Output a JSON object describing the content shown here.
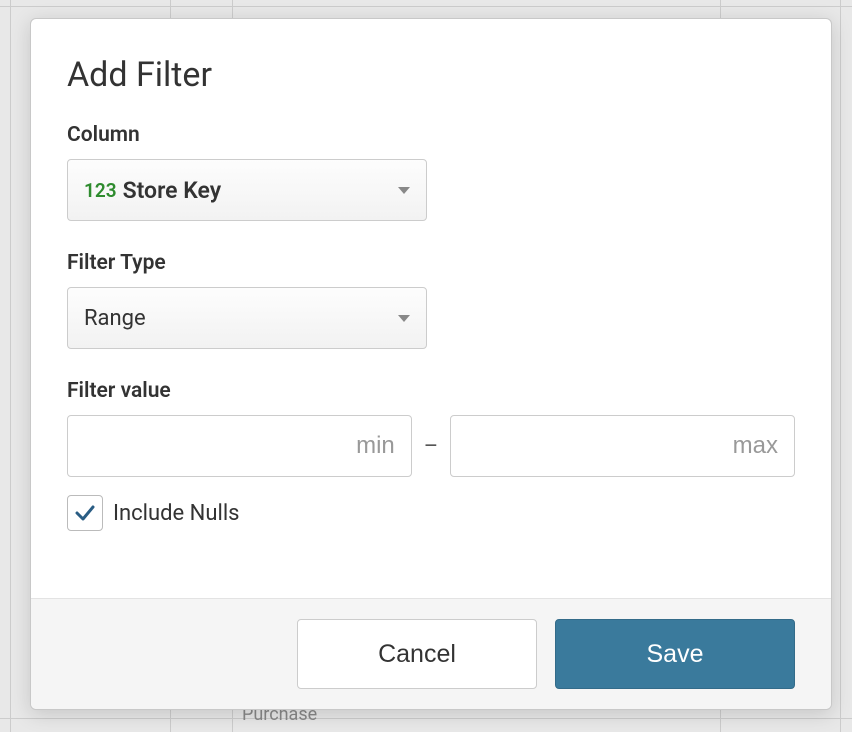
{
  "modal": {
    "title": "Add Filter",
    "column": {
      "label": "Column",
      "type_indicator": "123",
      "selected": "Store Key"
    },
    "filter_type": {
      "label": "Filter Type",
      "selected": "Range"
    },
    "filter_value": {
      "label": "Filter value",
      "min_placeholder": "min",
      "max_placeholder": "max",
      "min_value": "",
      "max_value": "",
      "separator": "–"
    },
    "include_nulls": {
      "label": "Include Nulls",
      "checked": true
    },
    "actions": {
      "cancel": "Cancel",
      "save": "Save"
    }
  },
  "background": {
    "partial_text": "Purchase"
  }
}
